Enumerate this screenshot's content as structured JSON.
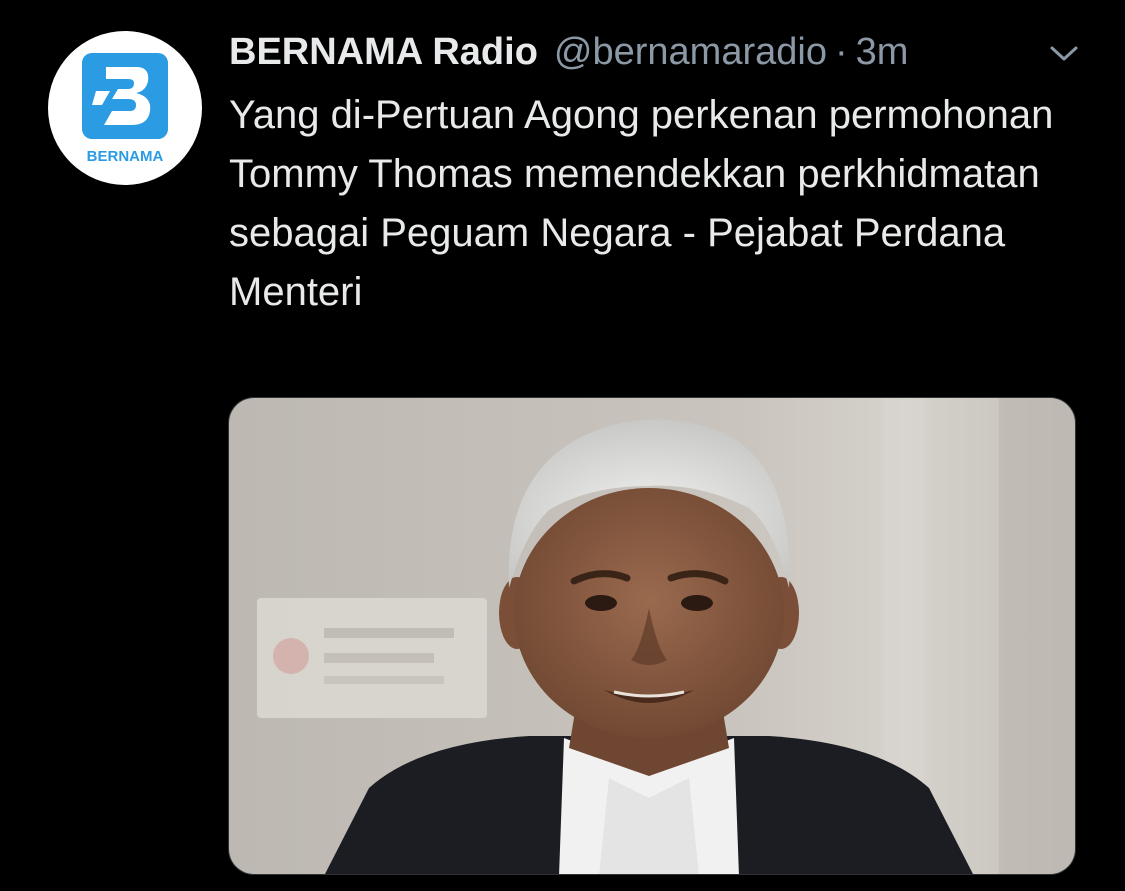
{
  "tweet": {
    "author": {
      "display_name": "BERNAMA Radio",
      "handle": "@bernamaradio",
      "avatar_logo_text": "BERNAMA",
      "avatar_icon": "bernama-logo-icon"
    },
    "separator": "·",
    "timestamp": "3m",
    "menu_icon": "chevron-down-icon",
    "text": "Yang di-Pertuan Agong perkenan permohonan Tommy Thomas memendekkan perkhidmatan sebagai Peguam Negara - Pejabat Perdana Menteri",
    "media": {
      "type": "photo"
    }
  },
  "colors": {
    "background": "#000000",
    "primary_text": "#e7e9ea",
    "secondary_text": "#8b98a5",
    "brand_blue": "#2b9be3"
  }
}
